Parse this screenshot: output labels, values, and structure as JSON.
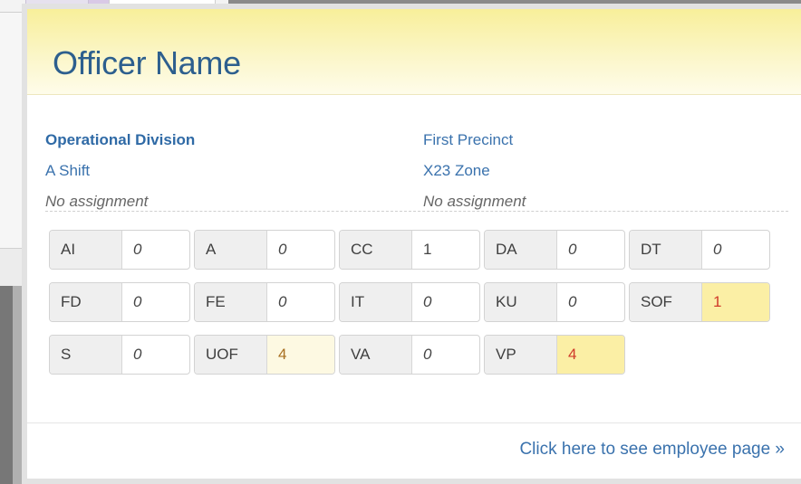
{
  "officer": {
    "name": "Officer Name"
  },
  "assignments": {
    "left": {
      "division": "Operational Division",
      "shift": "A Shift",
      "assignment": "No assignment"
    },
    "right": {
      "precinct": "First Precinct",
      "zone": "X23 Zone",
      "assignment": "No assignment"
    }
  },
  "stats": [
    {
      "label": "AI",
      "value": "0",
      "style": "zero"
    },
    {
      "label": "A",
      "value": "0",
      "style": "zero"
    },
    {
      "label": "CC",
      "value": "1",
      "style": "plain"
    },
    {
      "label": "DA",
      "value": "0",
      "style": "zero"
    },
    {
      "label": "DT",
      "value": "0",
      "style": "zero"
    },
    {
      "label": "FD",
      "value": "0",
      "style": "zero"
    },
    {
      "label": "FE",
      "value": "0",
      "style": "zero"
    },
    {
      "label": "IT",
      "value": "0",
      "style": "zero"
    },
    {
      "label": "KU",
      "value": "0",
      "style": "zero"
    },
    {
      "label": "SOF",
      "value": "1",
      "style": "warn"
    },
    {
      "label": "S",
      "value": "0",
      "style": "zero"
    },
    {
      "label": "UOF",
      "value": "4",
      "style": "soft"
    },
    {
      "label": "VA",
      "value": "0",
      "style": "zero"
    },
    {
      "label": "VP",
      "value": "4",
      "style": "warn"
    }
  ],
  "footer": {
    "link_label": "Click here to see employee page »"
  },
  "colors": {
    "header_yellow": "#f8ef9a",
    "link_blue": "#3a72ad",
    "warn_bg": "#fbefa5",
    "warn_text": "#d03a2a"
  }
}
